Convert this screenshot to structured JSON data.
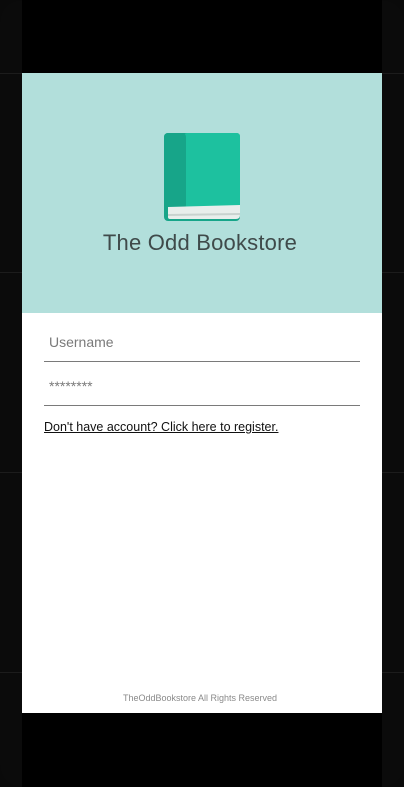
{
  "app": {
    "title": "The Odd Bookstore",
    "logo_icon": "book-icon",
    "header_color": "#b2dfdb",
    "logo_colors": {
      "cover": "#1dc19f",
      "spine": "#17a589",
      "pages": "#e8eeec"
    }
  },
  "login": {
    "username": {
      "placeholder": "Username",
      "value": ""
    },
    "password": {
      "placeholder": "********",
      "value": ""
    },
    "register_link": "Don't have account? Click here to register."
  },
  "footer": {
    "text": "TheOddBookstore All Rights Reserved"
  }
}
